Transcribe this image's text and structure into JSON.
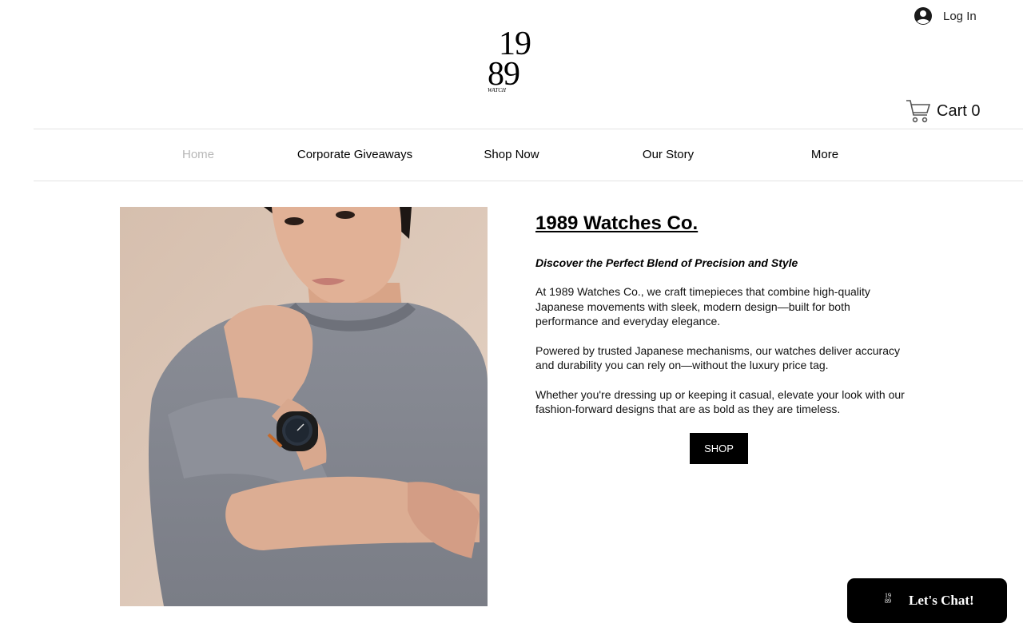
{
  "header": {
    "logo": {
      "top": "19",
      "bottom": "89",
      "sub": "WATCH"
    },
    "login_label": "Log In",
    "cart_label": "Cart",
    "cart_count": "0"
  },
  "nav": {
    "items": [
      {
        "label": "Home",
        "active": true
      },
      {
        "label": "Corporate Giveaways"
      },
      {
        "label": "Shop Now"
      },
      {
        "label": "Our Story"
      },
      {
        "label": "More"
      }
    ]
  },
  "main": {
    "title": "1989 Watches Co.",
    "tagline": "Discover the Perfect Blend of Precision and Style",
    "paragraphs": [
      "At 1989 Watches Co., we craft timepieces that combine high-quality Japanese movements with sleek, modern design—built for both performance and everyday elegance.",
      "Powered by trusted Japanese mechanisms, our watches deliver accuracy and durability you can rely on—without the luxury price tag.",
      "Whether you're dressing up or keeping it casual, elevate your look with our fashion-forward designs that are as bold as they are timeless."
    ],
    "shop_button": "SHOP"
  },
  "chat": {
    "logo_top": "19",
    "logo_bottom": "89",
    "label": "Let's Chat!"
  },
  "colors": {
    "accent": "#000000",
    "nav_active": "#b7b7b7",
    "divider": "#e3e3e3"
  }
}
